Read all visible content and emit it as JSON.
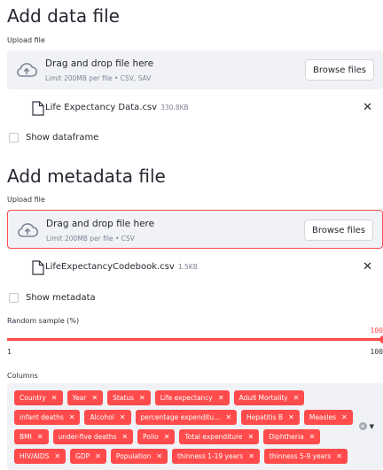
{
  "data_section": {
    "title": "Add data file",
    "upload_label": "Upload file",
    "drop_title": "Drag and drop file here",
    "drop_sub": "Limit 200MB per file • CSV, SAV",
    "browse_label": "Browse files",
    "file_name": "Life Expectancy Data.csv",
    "file_size": "330.8KB",
    "show_label": "Show dataframe"
  },
  "meta_section": {
    "title": "Add metadata file",
    "upload_label": "Upload file",
    "drop_title": "Drag and drop file here",
    "drop_sub": "Limit 200MB per file • CSV",
    "browse_label": "Browse files",
    "file_name": "LifeExpectancyCodebook.csv",
    "file_size": "1.5KB",
    "show_label": "Show metadata"
  },
  "slider": {
    "label": "Random sample (%)",
    "value": "100",
    "min": "1",
    "max": "100"
  },
  "columns": {
    "label": "Columns",
    "tags": [
      "Country",
      "Year",
      "Status",
      "Life expectancy",
      "Adult Mortality",
      "infant deaths",
      "Alcohol",
      "percentage expenditu...",
      "Hepatitis B",
      "Measles",
      "BMI",
      "under-five deaths",
      "Polio",
      "Total expenditure",
      "Diphtheria",
      "HIV/AIDS",
      "GDP",
      "Population",
      "thinness 1-19 years",
      "thinness 5-9 years"
    ]
  },
  "colors": {
    "accent": "#ff4b4b",
    "panel": "#f0f2f6"
  }
}
